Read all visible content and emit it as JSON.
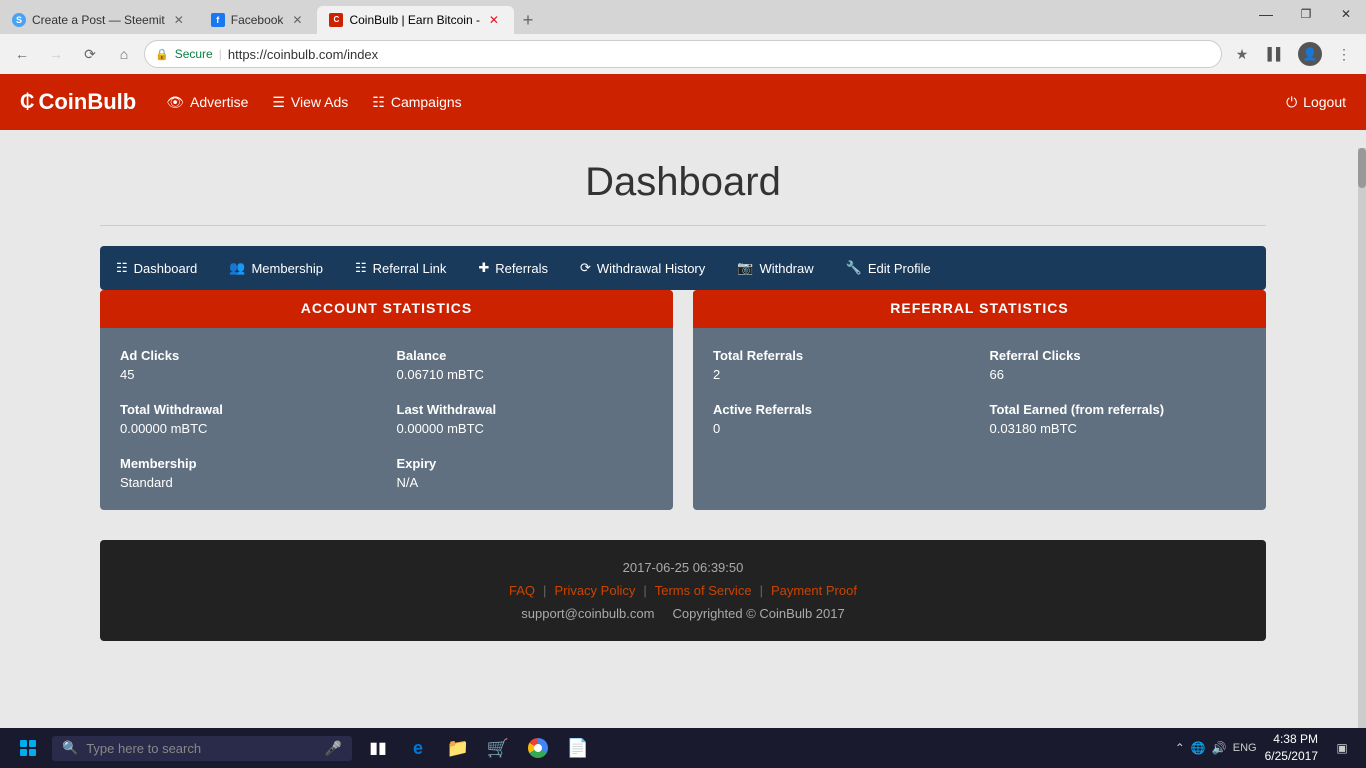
{
  "browser": {
    "tabs": [
      {
        "id": "tab1",
        "title": "Create a Post — Steemit",
        "favicon": "S",
        "favicon_color": "#4ba2f2",
        "active": false
      },
      {
        "id": "tab2",
        "title": "Facebook",
        "favicon": "f",
        "favicon_color": "#1877f2",
        "active": false
      },
      {
        "id": "tab3",
        "title": "CoinBulb | Earn Bitcoin -",
        "favicon": "C",
        "favicon_color": "#cc2200",
        "active": true
      }
    ],
    "url": "https://coinbulb.com/index",
    "secure_label": "Secure"
  },
  "navbar": {
    "brand": "CoinBulb",
    "advertise_label": "Advertise",
    "viewads_label": "View Ads",
    "campaigns_label": "Campaigns",
    "logout_label": "Logout"
  },
  "page": {
    "title": "Dashboard"
  },
  "dashboard_nav": {
    "items": [
      {
        "label": "Dashboard",
        "icon": "grid"
      },
      {
        "label": "Membership",
        "icon": "users"
      },
      {
        "label": "Referral Link",
        "icon": "grid4"
      },
      {
        "label": "Referrals",
        "icon": "plus"
      },
      {
        "label": "Withdrawal History",
        "icon": "history"
      },
      {
        "label": "Withdraw",
        "icon": "camera"
      },
      {
        "label": "Edit Profile",
        "icon": "wrench"
      }
    ]
  },
  "account_stats": {
    "header": "ACCOUNT STATISTICS",
    "ad_clicks_label": "Ad Clicks",
    "ad_clicks_value": "45",
    "balance_label": "Balance",
    "balance_value": "0.06710 mBTC",
    "total_withdrawal_label": "Total Withdrawal",
    "total_withdrawal_value": "0.00000 mBTC",
    "last_withdrawal_label": "Last Withdrawal",
    "last_withdrawal_value": "0.00000 mBTC",
    "membership_label": "Membership",
    "membership_value": "Standard",
    "expiry_label": "Expiry",
    "expiry_value": "N/A"
  },
  "referral_stats": {
    "header": "REFERRAL STATISTICS",
    "total_referrals_label": "Total Referrals",
    "total_referrals_value": "2",
    "referral_clicks_label": "Referral Clicks",
    "referral_clicks_value": "66",
    "active_referrals_label": "Active Referrals",
    "active_referrals_value": "0",
    "total_earned_label": "Total Earned (from referrals)",
    "total_earned_value": "0.03180 mBTC"
  },
  "footer": {
    "timestamp": "2017-06-25 06:39:50",
    "faq_label": "FAQ",
    "privacy_label": "Privacy Policy",
    "tos_label": "Terms of Service",
    "payment_proof_label": "Payment Proof",
    "support_email": "support@coinbulb.com",
    "copyright": "Copyrighted © CoinBulb 2017"
  },
  "taskbar": {
    "search_placeholder": "Type here to search",
    "time": "4:38 PM",
    "date": "6/25/2017"
  }
}
